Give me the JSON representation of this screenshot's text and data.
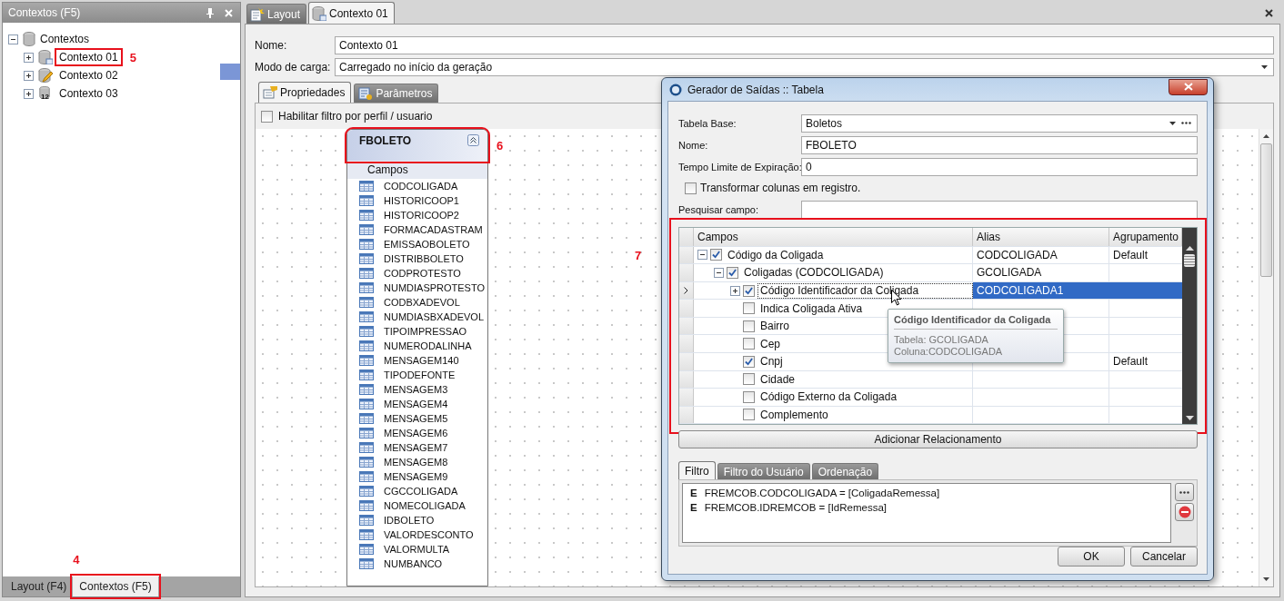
{
  "left_panel": {
    "title": "Contextos (F5)",
    "tree": {
      "label": "Contextos",
      "expanded": true,
      "children": [
        {
          "label": "Contexto 01",
          "expanded": false,
          "annotation": "5"
        },
        {
          "label": "Contexto 02",
          "expanded": false
        },
        {
          "label": "Contexto 03",
          "expanded": false,
          "icon_badge": "12"
        }
      ]
    },
    "bottom_tabs": [
      {
        "label": "Layout (F4)",
        "selected": false
      },
      {
        "label": "Contextos (F5)",
        "selected": true,
        "annotation": "4"
      }
    ]
  },
  "document_tabs": [
    {
      "label": "Layout",
      "selected": false
    },
    {
      "label": "Contexto 01",
      "selected": true
    }
  ],
  "form": [
    {
      "label": "Nome:",
      "value": "Contexto 01",
      "kind": "text"
    },
    {
      "label": "Modo de carga:",
      "value": "Carregado no início da geração",
      "kind": "combo"
    }
  ],
  "inner_tabs": [
    {
      "label": "Propriedades",
      "selected": true
    },
    {
      "label": "Parâmetros",
      "selected": false
    }
  ],
  "profile_filter": {
    "label": "Habilitar filtro por perfil / usuario",
    "checked": false
  },
  "table_card": {
    "title": "FBOLETO",
    "annotation": "6",
    "section": "Campos",
    "fields": [
      "CODCOLIGADA",
      "HISTORICOOP1",
      "HISTORICOOP2",
      "FORMACADASTRAM",
      "EMISSAOBOLETO",
      "DISTRIBBOLETO",
      "CODPROTESTO",
      "NUMDIASPROTESTO",
      "CODBXADEVOL",
      "NUMDIASBXADEVOL",
      "TIPOIMPRESSAO",
      "NUMERODALINHA",
      "MENSAGEM140",
      "TIPODEFONTE",
      "MENSAGEM3",
      "MENSAGEM4",
      "MENSAGEM5",
      "MENSAGEM6",
      "MENSAGEM7",
      "MENSAGEM8",
      "MENSAGEM9",
      "CGCCOLIGADA",
      "NOMECOLIGADA",
      "IDBOLETO",
      "VALORDESCONTO",
      "VALORMULTA",
      "NUMBANCO"
    ]
  },
  "dialog": {
    "title": "Gerador de Saídas :: Tabela",
    "fields": [
      {
        "label": "Tabela Base:",
        "value": "Boletos",
        "kind": "combo"
      },
      {
        "label": "Nome:",
        "value": "FBOLETO",
        "kind": "text"
      },
      {
        "label": "Tempo Limite de Expiração:",
        "value": "0",
        "kind": "text"
      }
    ],
    "transform": {
      "label": "Transformar colunas em registro.",
      "checked": false
    },
    "search": {
      "label": "Pesquisar campo:"
    },
    "grid": {
      "annotation": "7",
      "columns": [
        "Campos",
        "Alias",
        "Agrupamento"
      ],
      "rows": [
        {
          "field": "Código da Coligada",
          "alias": "CODCOLIGADA",
          "grouping": "Default",
          "checked": true,
          "expanded": true,
          "selected": false,
          "children": [
            {
              "field": "Coligadas (CODCOLIGADA)",
              "alias": "GCOLIGADA",
              "checked": true,
              "expanded": true,
              "selected": false,
              "children": [
                {
                  "field": "Código Identificador da Coligada",
                  "alias": "CODCOLIGADA1",
                  "checked": true,
                  "expanded": false,
                  "selected": true
                },
                {
                  "field": "Indica Coligada Ativa",
                  "checked": false,
                  "selected": false
                },
                {
                  "field": "Bairro",
                  "checked": false,
                  "selected": false
                },
                {
                  "field": "Cep",
                  "checked": false,
                  "selected": false
                },
                {
                  "field": "Cnpj",
                  "grouping": "Default",
                  "checked": true,
                  "selected": false
                },
                {
                  "field": "Cidade",
                  "checked": false,
                  "selected": false
                },
                {
                  "field": "Código Externo da Coligada",
                  "checked": false,
                  "selected": false
                },
                {
                  "field": "Complemento",
                  "checked": false,
                  "selected": false
                }
              ]
            }
          ]
        }
      ]
    },
    "tooltip": {
      "title": "Código Identificador da Coligada",
      "lines": [
        "Tabela: GCOLIGADA",
        "Coluna:CODCOLIGADA"
      ]
    },
    "add_button": "Adicionar Relacionamento",
    "tabs": [
      {
        "label": "Filtro",
        "selected": true
      },
      {
        "label": "Filtro do Usuário",
        "selected": false
      },
      {
        "label": "Ordenação",
        "selected": false
      }
    ],
    "filters": [
      {
        "marker": "E",
        "expression": "FREMCOB.CODCOLIGADA = [ColigadaRemessa]"
      },
      {
        "marker": "E",
        "expression": "FREMCOB.IDREMCOB = [IdRemessa]"
      }
    ],
    "buttons": [
      "OK",
      "Cancelar"
    ]
  }
}
